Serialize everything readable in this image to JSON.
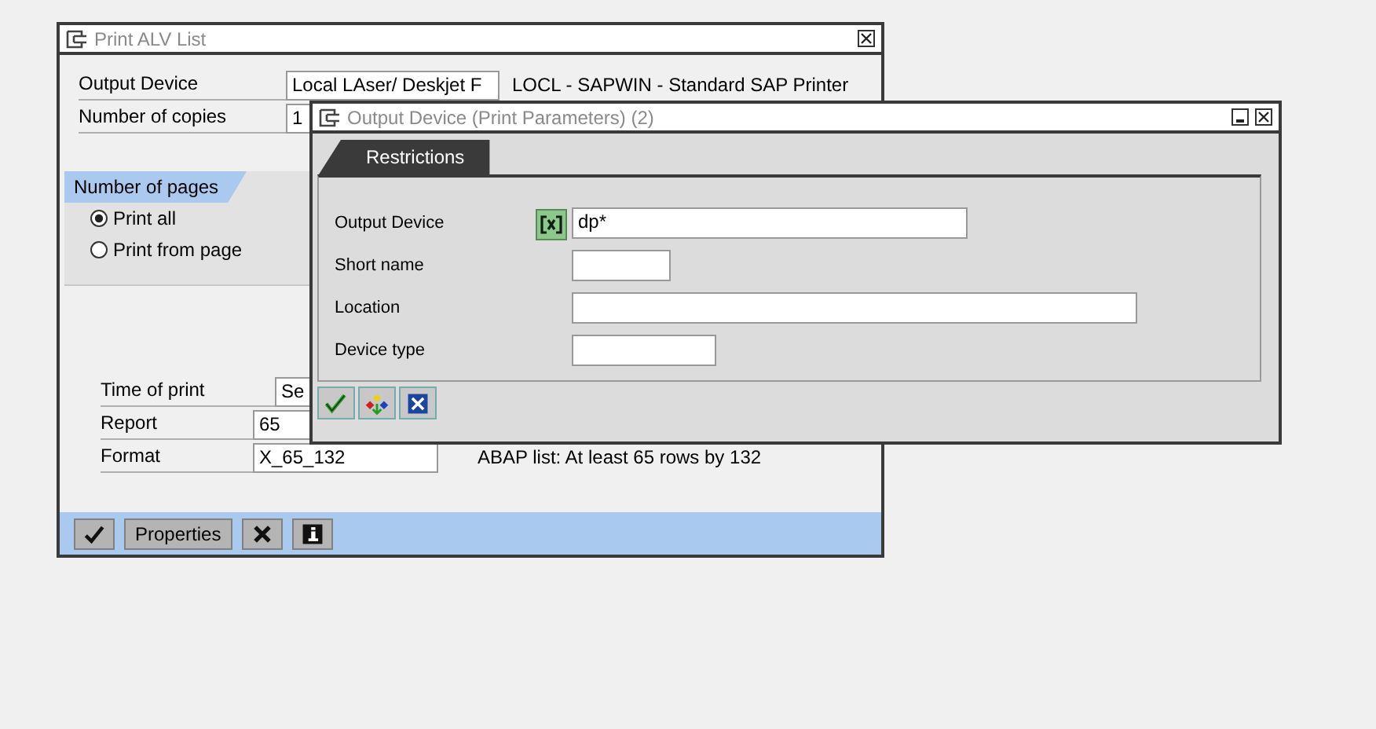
{
  "print_window": {
    "title": "Print ALV List",
    "fields": [
      {
        "label": "Output Device",
        "value": "Local LAser/ Deskjet F",
        "description": "LOCL - SAPWIN - Standard SAP Printer"
      },
      {
        "label": "Number of copies",
        "value": "1"
      }
    ],
    "pages_group": {
      "title": "Number of pages",
      "options": [
        {
          "label": "Print all",
          "selected": true
        },
        {
          "label": "Print from page",
          "selected": false
        }
      ]
    },
    "settings": [
      {
        "label": "Time of print",
        "value": "Se"
      },
      {
        "label": "Report",
        "value": "65"
      },
      {
        "label": "Format",
        "value": "X_65_132",
        "description": "ABAP list: At least 65 rows by 132"
      }
    ],
    "toolbar": [
      {
        "kind": "confirm"
      },
      {
        "kind": "text",
        "label": "Properties"
      },
      {
        "kind": "cancel"
      },
      {
        "kind": "info"
      }
    ]
  },
  "dialog": {
    "title": "Output Device (Print Parameters) (2)",
    "tabs": [
      {
        "label": "Restrictions",
        "selected": true
      }
    ],
    "fields": [
      {
        "label": "Output Device",
        "value": "dp*",
        "kind": "multi"
      },
      {
        "label": "Short name",
        "kind": "plain"
      },
      {
        "label": "Location",
        "kind": "plain"
      },
      {
        "label": "Device type",
        "kind": "plain"
      }
    ],
    "buttons": [
      {
        "kind": "confirm"
      },
      {
        "kind": "hierarchy"
      },
      {
        "kind": "cancel"
      }
    ]
  }
}
